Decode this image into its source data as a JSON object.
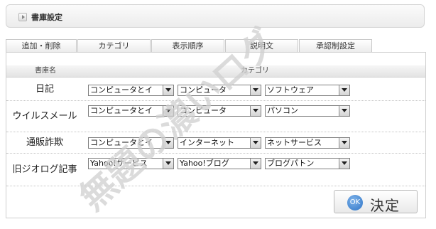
{
  "header": {
    "title": "書庫設定"
  },
  "tabs": [
    {
      "label": "追加・削除"
    },
    {
      "label": "カテゴリ"
    },
    {
      "label": "表示順序"
    },
    {
      "label": "説明文"
    },
    {
      "label": "承認制設定"
    }
  ],
  "table": {
    "col1_header": "書庫名",
    "col2_header": "カテゴリ",
    "rows": [
      {
        "name": "日記",
        "cats": [
          "コンピュータとイ",
          "コンピュータ",
          "ソフトウェア"
        ]
      },
      {
        "name": "ウイルスメール",
        "cats": [
          "コンピュータとイ",
          "コンピュータ",
          "パソコン"
        ]
      },
      {
        "name": "通販詐欺",
        "cats": [
          "コンピュータとイ",
          "インターネット",
          "ネットサービス"
        ]
      },
      {
        "name": "旧ジオログ記事",
        "cats": [
          "Yahoo!サービス",
          "Yahoo!ブログ",
          "ブログパトン"
        ]
      }
    ]
  },
  "submit": {
    "icon_text": "OK",
    "label": "決定"
  },
  "watermark": {
    "text": "無題の濃いログ",
    "color": "#cfcfcf"
  }
}
